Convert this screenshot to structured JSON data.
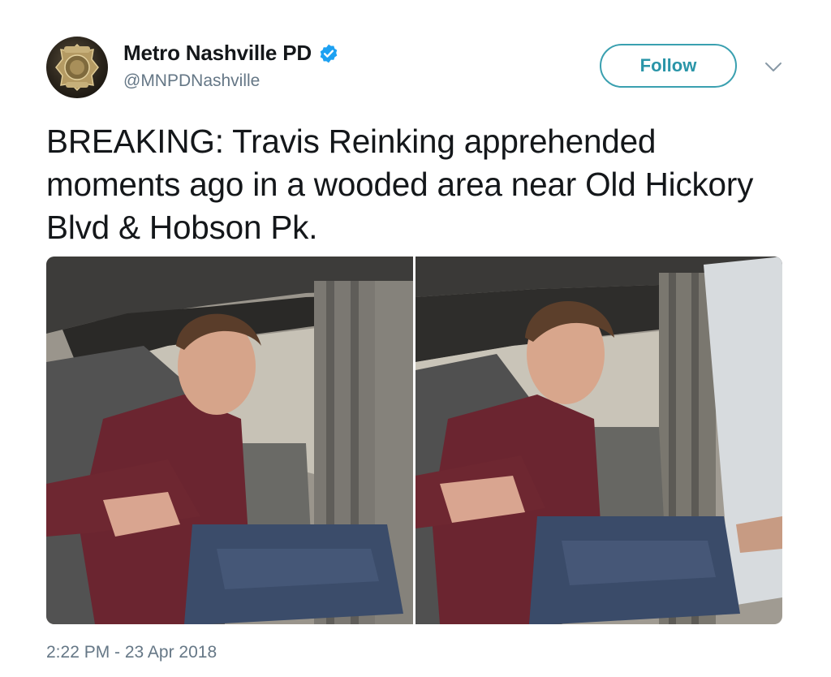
{
  "author": {
    "display_name": "Metro Nashville PD",
    "handle": "@MNPDNashville",
    "verified": true,
    "avatar_icon": "police-badge-icon"
  },
  "actions": {
    "follow_label": "Follow",
    "menu_icon": "chevron-down-icon"
  },
  "tweet": {
    "text": "BREAKING: Travis Reinking apprehended moments ago in a wooded area near Old Hickory Blvd & Hobson Pk.",
    "timestamp": "2:22 PM - 23 Apr 2018"
  },
  "colors": {
    "accent": "#2a95a8",
    "verified_blue": "#1da1f2",
    "secondary_text": "#657786",
    "primary_text": "#14171a"
  }
}
